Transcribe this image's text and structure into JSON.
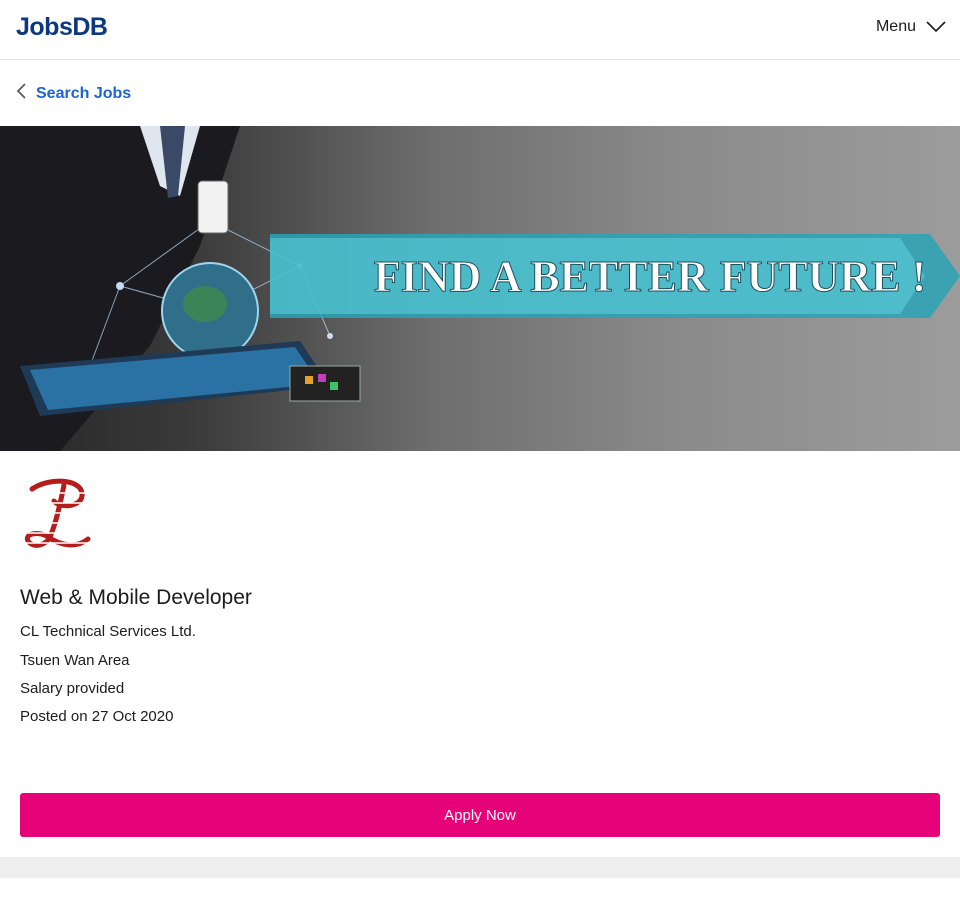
{
  "header": {
    "logo_text": "JobsDB",
    "menu_label": "Menu",
    "menu_icon": "chevron-down-icon"
  },
  "nav": {
    "back_label": "Search Jobs",
    "back_icon": "chevron-left-icon"
  },
  "banner": {
    "headline": "FIND A BETTER FUTURE !"
  },
  "job": {
    "title": "Web & Mobile Developer",
    "company": "CL Technical Services Ltd.",
    "location": "Tsuen Wan Area",
    "salary": "Salary provided",
    "posted_prefix": "Posted on",
    "posted_date": "27 Oct 2020"
  },
  "actions": {
    "apply_label": "Apply Now"
  },
  "colors": {
    "brand": "#0d3880",
    "link": "#1d63d6",
    "apply": "#e60278",
    "company_logo": "#b51d1d"
  }
}
